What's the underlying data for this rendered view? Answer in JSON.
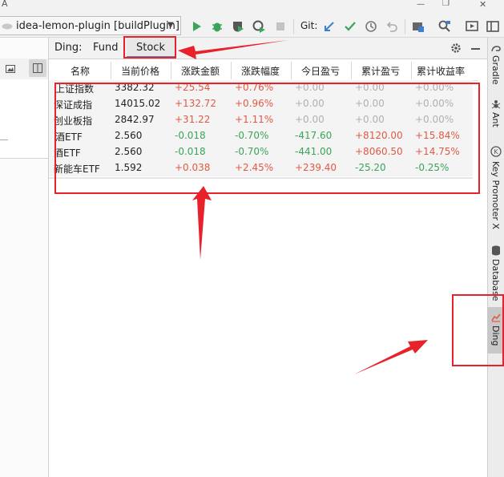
{
  "toolbar": {
    "run_config": "idea-lemon-plugin [buildPlugin]",
    "git_label": "Git:"
  },
  "tool_window": {
    "title": "Ding:",
    "tabs": [
      "Fund",
      "Stock"
    ],
    "active_tab": "Stock"
  },
  "table": {
    "columns": [
      "名称",
      "当前价格",
      "涨跌金额",
      "涨跌幅度",
      "今日盈亏",
      "累计盈亏",
      "累计收益率"
    ],
    "rows": [
      {
        "name": "上证指数",
        "price": "3382.32",
        "change": "+25.54",
        "pct": "+0.76%",
        "today": "+0.00",
        "total": "+0.00",
        "rate": "+0.00%"
      },
      {
        "name": "深证成指",
        "price": "14015.02",
        "change": "+132.72",
        "pct": "+0.96%",
        "today": "+0.00",
        "total": "+0.00",
        "rate": "+0.00%"
      },
      {
        "name": "创业板指",
        "price": "2842.97",
        "change": "+31.22",
        "pct": "+1.11%",
        "today": "+0.00",
        "total": "+0.00",
        "rate": "+0.00%"
      },
      {
        "name": "酒ETF",
        "price": "2.560",
        "change": "-0.018",
        "pct": "-0.70%",
        "today": "-417.60",
        "total": "+8120.00",
        "rate": "+15.84%"
      },
      {
        "name": "酒ETF",
        "price": "2.560",
        "change": "-0.018",
        "pct": "-0.70%",
        "today": "-441.00",
        "total": "+8060.50",
        "rate": "+14.75%"
      },
      {
        "name": "新能车ETF",
        "price": "1.592",
        "change": "+0.038",
        "pct": "+2.45%",
        "today": "+239.40",
        "total": "-25.20",
        "rate": "-0.25%"
      }
    ]
  },
  "right_sidebar": {
    "items": [
      "Gradle",
      "Ant",
      "Key Promoter X",
      "Database",
      "Ding"
    ]
  },
  "colors": {
    "positive": "#e05a45",
    "negative": "#3aa55a",
    "zero": "#b0b0b0",
    "annotation": "#e8222a",
    "tab_underline": "#4a88c7"
  }
}
